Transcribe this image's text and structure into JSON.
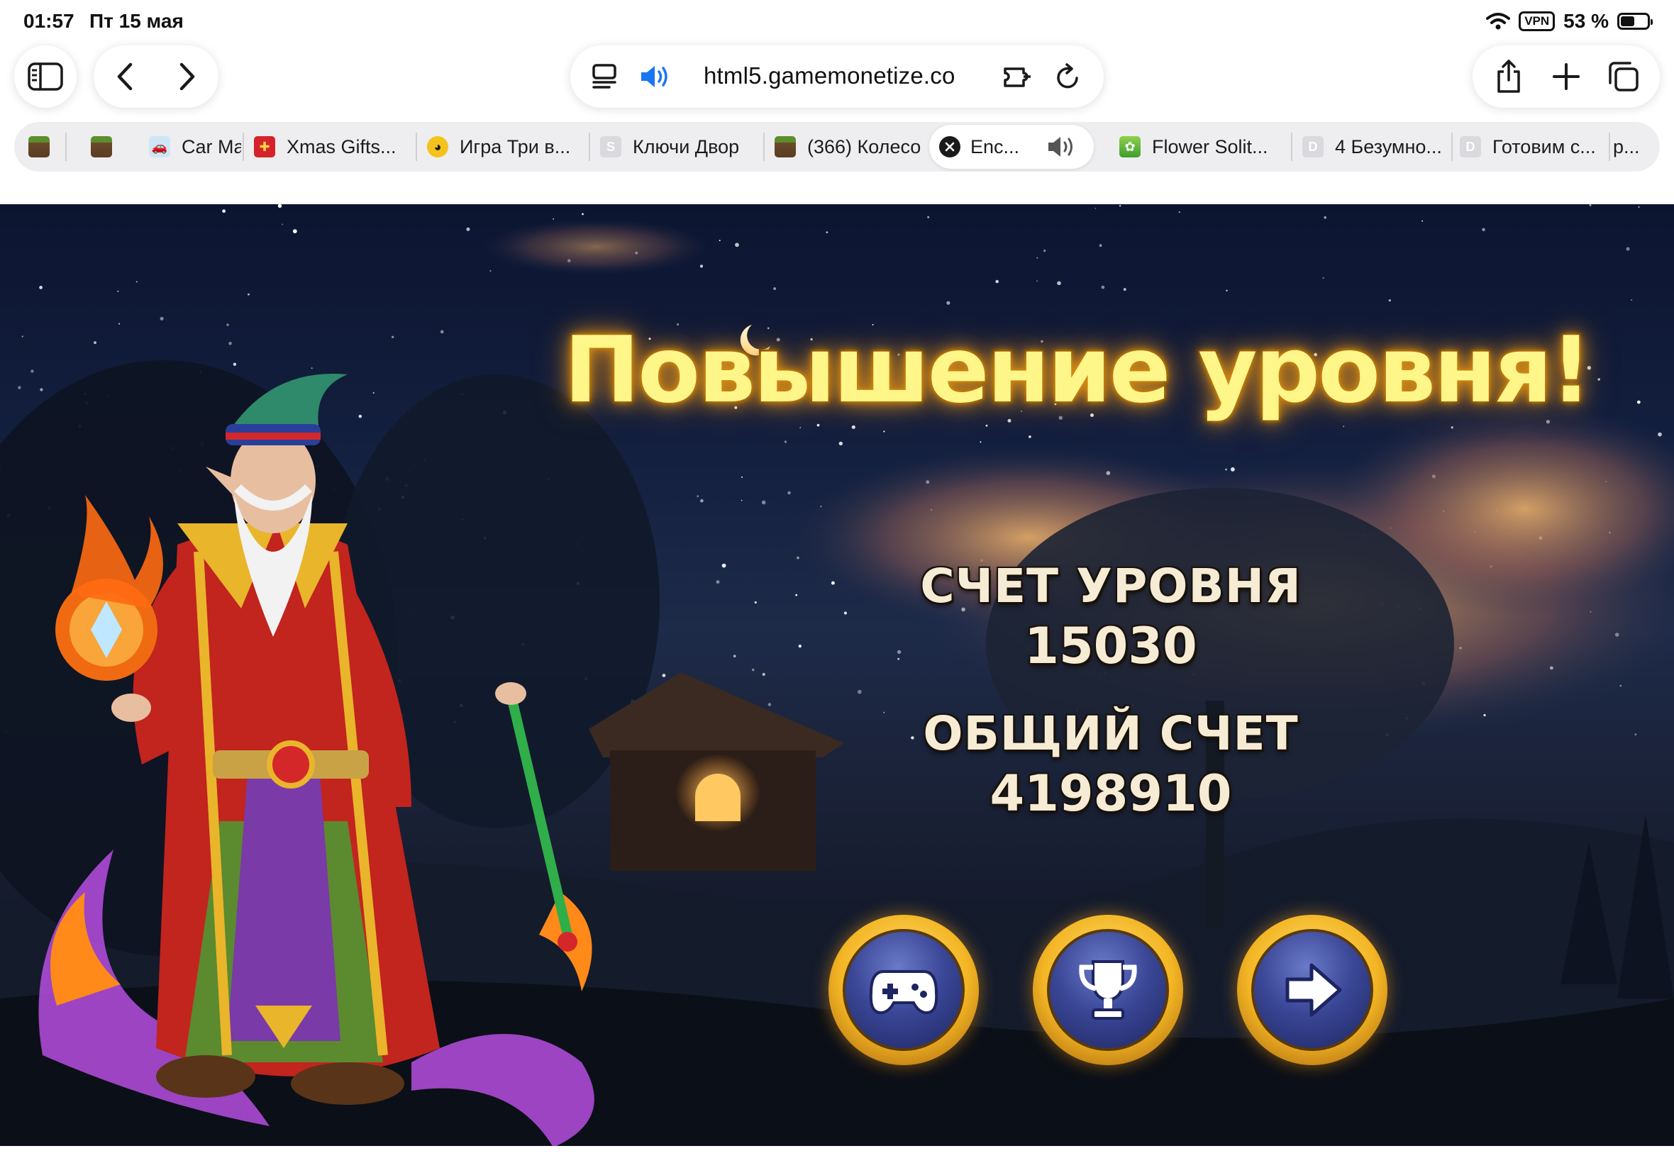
{
  "status_bar": {
    "time": "01:57",
    "date": "Пт 15 мая",
    "vpn": "VPN",
    "battery_percent": "53 %",
    "battery_level": 0.53
  },
  "toolbar": {
    "sidebar_icon": "sidebar-icon",
    "back_icon": "chevron-left-icon",
    "forward_icon": "chevron-right-icon",
    "reader_icon": "reader-icon",
    "audio_icon": "speaker-icon",
    "url": "html5.gamemonetize.co",
    "extensions_icon": "extension-icon",
    "reload_icon": "reload-icon",
    "share_icon": "share-icon",
    "new_tab_icon": "plus-icon",
    "tabs_icon": "tabs-icon"
  },
  "tabs": [
    {
      "label": "",
      "favicon": "minecraft-icon"
    },
    {
      "label": "",
      "favicon": "minecraft-icon"
    },
    {
      "label": "Car Ma",
      "favicon": "car-icon"
    },
    {
      "label": "Xmas Gifts...",
      "favicon": "gift-icon"
    },
    {
      "label": "Игра Три в...",
      "favicon": "duck-icon"
    },
    {
      "label": "Ключи Двор",
      "favicon": "letter-s-icon"
    },
    {
      "label": "(366) Колесо",
      "favicon": "minecraft-icon"
    },
    {
      "label": "Enc...",
      "favicon": "close-icon",
      "active": true,
      "audio": true
    },
    {
      "label": "Flower Solit...",
      "favicon": "flower-icon"
    },
    {
      "label": "4 Безумно...",
      "favicon": "letter-d-icon"
    },
    {
      "label": "Готовим с...",
      "favicon": "letter-d-icon"
    },
    {
      "label": "р...",
      "favicon": ""
    }
  ],
  "game": {
    "title": "Повышение уровня!",
    "level_score_label": "СЧЕТ УРОВНЯ",
    "level_score_value": "15030",
    "total_score_label": "ОБЩИЙ СЧЕТ",
    "total_score_value": "4198910",
    "buttons": [
      {
        "icon": "gamepad-icon"
      },
      {
        "icon": "trophy-icon"
      },
      {
        "icon": "arrow-right-icon"
      }
    ],
    "colors": {
      "title_fill": "#fff68a",
      "title_glow": "#d08a12",
      "button_ring": "#f3b524",
      "button_face": "#3a4796"
    }
  }
}
